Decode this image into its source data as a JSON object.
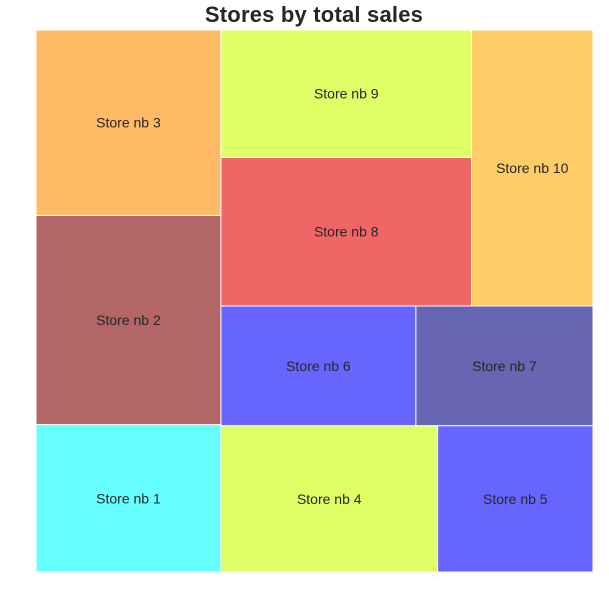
{
  "chart_data": {
    "type": "treemap",
    "title": "Stores by total sales",
    "series": [
      {
        "label": "Store nb 1",
        "color": "#00FFFF",
        "alpha": 0.6
      },
      {
        "label": "Store nb 2",
        "color": "#800000",
        "alpha": 0.6
      },
      {
        "label": "Store nb 3",
        "color": "#FF8C00",
        "alpha": 0.6
      },
      {
        "label": "Store nb 4",
        "color": "#CCFF00",
        "alpha": 0.6
      },
      {
        "label": "Store nb 5",
        "color": "#0000FF",
        "alpha": 0.6
      },
      {
        "label": "Store nb 6",
        "color": "#0000FF",
        "alpha": 0.6
      },
      {
        "label": "Store nb 7",
        "color": "#000080",
        "alpha": 0.6
      },
      {
        "label": "Store nb 8",
        "color": "#E60000",
        "alpha": 0.6
      },
      {
        "label": "Store nb 9",
        "color": "#CCFF00",
        "alpha": 0.6
      },
      {
        "label": "Store nb 10",
        "color": "#FFAA00",
        "alpha": 0.6
      }
    ],
    "tiles": [
      {
        "label": "Store nb 1",
        "x0": 0,
        "y0": 0,
        "x1": 33.2,
        "y1": 27.2
      },
      {
        "label": "Store nb 2",
        "x0": 0,
        "y0": 27.2,
        "x1": 33.2,
        "y1": 65.8
      },
      {
        "label": "Store nb 3",
        "x0": 0,
        "y0": 65.8,
        "x1": 33.2,
        "y1": 100
      },
      {
        "label": "Store nb 4",
        "x0": 33.2,
        "y0": 0,
        "x1": 72.1,
        "y1": 27.0
      },
      {
        "label": "Store nb 5",
        "x0": 72.1,
        "y0": 0,
        "x1": 100,
        "y1": 27.0
      },
      {
        "label": "Store nb 6",
        "x0": 33.2,
        "y0": 27.0,
        "x1": 68.2,
        "y1": 49.1
      },
      {
        "label": "Store nb 7",
        "x0": 68.2,
        "y0": 27.0,
        "x1": 100,
        "y1": 49.1
      },
      {
        "label": "Store nb 8",
        "x0": 33.2,
        "y0": 49.1,
        "x1": 78.2,
        "y1": 76.5
      },
      {
        "label": "Store nb 9",
        "x0": 33.2,
        "y0": 76.5,
        "x1": 78.2,
        "y1": 100
      },
      {
        "label": "Store nb 10",
        "x0": 78.2,
        "y0": 49.1,
        "x1": 100,
        "y1": 100
      }
    ],
    "xlim": [
      0,
      100
    ],
    "ylim": [
      0,
      100
    ],
    "axis": "off",
    "grid": false,
    "legend": "none"
  }
}
